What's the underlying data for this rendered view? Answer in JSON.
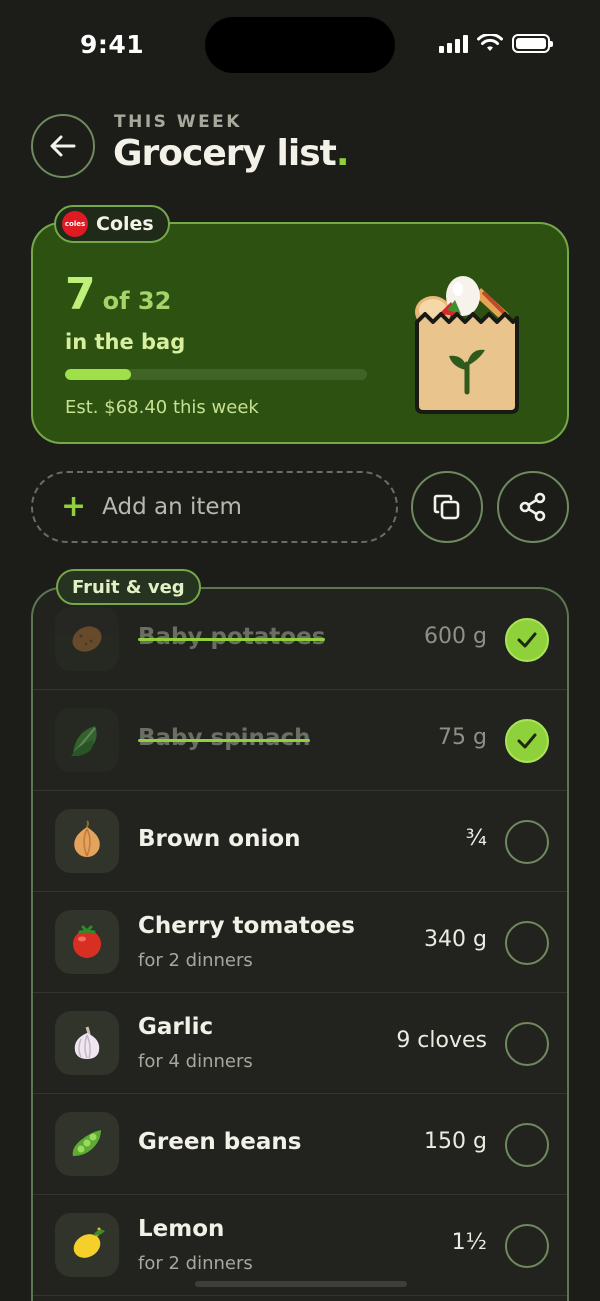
{
  "status": {
    "time": "9:41"
  },
  "header": {
    "overline": "THIS WEEK",
    "title": "Grocery list",
    "title_dot": "."
  },
  "summary": {
    "store": "Coles",
    "store_logo_text": "coles",
    "checked_count": "7",
    "of_total": "of 32",
    "bag_label": "in the bag",
    "progress_fraction": 0.22,
    "estimate": "Est. $68.40 this week"
  },
  "actions": {
    "add_plus": "+",
    "add_placeholder": "Add an item",
    "copy_icon": "copy-icon",
    "share_icon": "share-icon"
  },
  "section": {
    "title": "Fruit & veg",
    "items": [
      {
        "name": "Baby potatoes",
        "sub": "",
        "qty": "600 g",
        "checked": true,
        "icon": "potato"
      },
      {
        "name": "Baby spinach",
        "sub": "",
        "qty": "75 g",
        "checked": true,
        "icon": "leafy-green"
      },
      {
        "name": "Brown onion",
        "sub": "",
        "qty": "¾",
        "checked": false,
        "icon": "onion"
      },
      {
        "name": "Cherry tomatoes",
        "sub": "for 2 dinners",
        "qty": "340 g",
        "checked": false,
        "icon": "tomato"
      },
      {
        "name": "Garlic",
        "sub": "for 4 dinners",
        "qty": "9 cloves",
        "checked": false,
        "icon": "garlic"
      },
      {
        "name": "Green beans",
        "sub": "",
        "qty": "150 g",
        "checked": false,
        "icon": "pea-pod"
      },
      {
        "name": "Lemon",
        "sub": "for 2 dinners",
        "qty": "1½",
        "checked": false,
        "icon": "lemon"
      }
    ]
  },
  "colors": {
    "accent": "#8fd13a",
    "card": "#2d5111",
    "background": "#1c1d19"
  }
}
